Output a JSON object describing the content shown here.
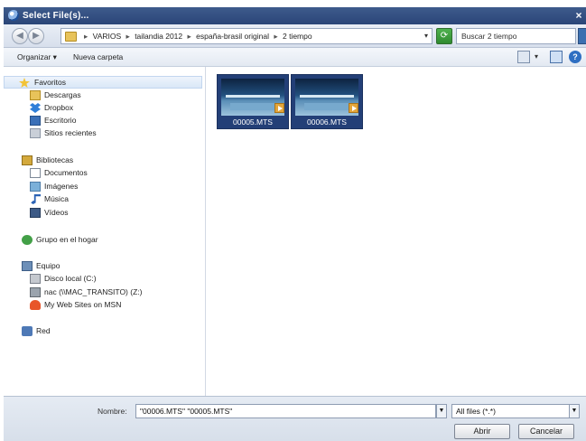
{
  "window": {
    "title": "Select File(s)..."
  },
  "address": {
    "crumbs": [
      "VARIOS",
      "tailandia 2012",
      "españa-brasil original",
      "2 tiempo"
    ],
    "search_placeholder": "Buscar 2 tiempo"
  },
  "toolbar": {
    "organize": "Organizar ▾",
    "new_folder": "Nueva carpeta"
  },
  "sidebar": {
    "items": [
      {
        "label": "Favoritos",
        "icon": "star-icon"
      },
      {
        "label": "Descargas",
        "icon": "folder-icon"
      },
      {
        "label": "Dropbox",
        "icon": "dropbox-icon"
      },
      {
        "label": "Escritorio",
        "icon": "desktop-icon"
      },
      {
        "label": "Sitios recientes",
        "icon": "recent-places-icon"
      },
      {
        "label": "Bibliotecas",
        "icon": "libraries-icon"
      },
      {
        "label": "Documentos",
        "icon": "documents-icon"
      },
      {
        "label": "Imágenes",
        "icon": "pictures-icon"
      },
      {
        "label": "Música",
        "icon": "music-icon"
      },
      {
        "label": "Vídeos",
        "icon": "videos-icon"
      },
      {
        "label": "Grupo en el hogar",
        "icon": "homegroup-icon"
      },
      {
        "label": "Equipo",
        "icon": "computer-icon"
      },
      {
        "label": "Disco local (C:)",
        "icon": "disk-icon"
      },
      {
        "label": "nac (\\\\MAC_TRANSITO) (Z:)",
        "icon": "network-drive-icon"
      },
      {
        "label": "My Web Sites on MSN",
        "icon": "msn-icon"
      },
      {
        "label": "Red",
        "icon": "network-icon"
      }
    ]
  },
  "files": [
    {
      "name": "00005.MTS"
    },
    {
      "name": "00006.MTS"
    }
  ],
  "bottom": {
    "filename_label": "Nombre:",
    "filename_value": "\"00006.MTS\" \"00005.MTS\"",
    "filter_value": "All files (*.*)",
    "open_label": "Abrir",
    "cancel_label": "Cancelar"
  }
}
